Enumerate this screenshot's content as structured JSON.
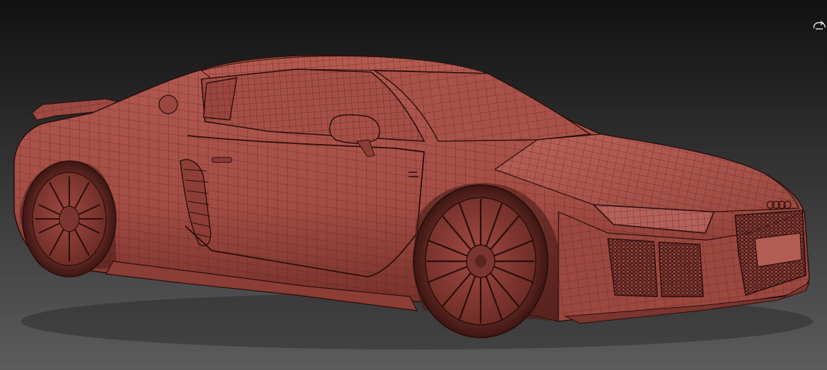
{
  "viewport": {
    "background_top": "#111111",
    "background_bottom": "#5c5c5c",
    "mesh_fill": "#a9524a",
    "mesh_shadow": "#5a2520",
    "wire_color": "#4a1c17",
    "edge_color": "#2a0e0b"
  },
  "icons": {
    "gizmo": "viewcube-gizmo-icon"
  }
}
